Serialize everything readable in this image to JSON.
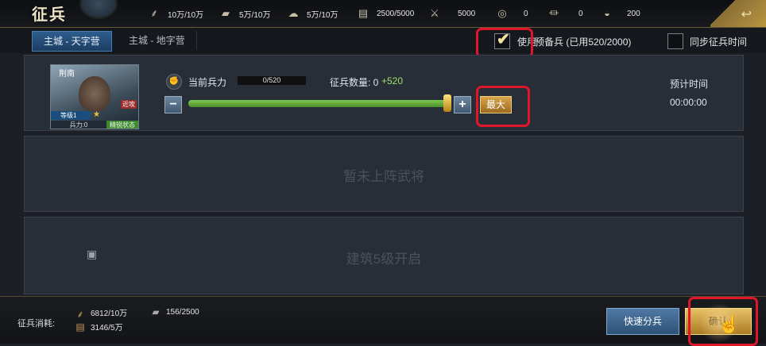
{
  "header": {
    "title": "征兵",
    "resources": [
      {
        "icon": "wood-icon",
        "value": "10万/10万"
      },
      {
        "icon": "iron-icon",
        "value": "5万/10万"
      },
      {
        "icon": "stone-icon",
        "value": "5万/10万"
      },
      {
        "icon": "grain-icon",
        "value": "2500/5000"
      },
      {
        "icon": "decree-icon",
        "value": "5000"
      },
      {
        "icon": "coin-icon",
        "value": "0"
      },
      {
        "icon": "gold-ingot-icon",
        "value": "0"
      },
      {
        "icon": "jade-icon",
        "value": "200"
      }
    ]
  },
  "tabs": [
    {
      "label": "主城 - 天字营",
      "active": true
    },
    {
      "label": "主城 - 地字营",
      "active": false
    }
  ],
  "options": {
    "use_reserve_label": "使用",
    "reserve_info": "预备兵 (已用520/2000)",
    "sync_label": "同步征兵时间"
  },
  "general": {
    "name": "荆南",
    "tag": "近攻",
    "level": "等级1",
    "troops": "兵力:0",
    "state": "精锐状态",
    "current_troops_label": "当前兵力",
    "current_troops_bar": "0/520",
    "recruit_count_label": "征兵数量: 0",
    "recruit_count_add": "+520",
    "recruit_fill_fraction": 1,
    "max_label": "最大",
    "est_time_label": "预计时间",
    "est_time_value": "00:00:00"
  },
  "slots": {
    "empty_text": "暂未上阵武将",
    "locked_text": "建筑5级开启"
  },
  "footer": {
    "cost_label": "征兵消耗:",
    "costs": [
      {
        "icon": "wood-icon",
        "value": "6812/10万"
      },
      {
        "icon": "iron-icon",
        "value": "156/2500"
      },
      {
        "icon": "grain-icon",
        "value": "3146/5万"
      }
    ],
    "quick_split_label": "快速分兵",
    "confirm_label": "确认"
  }
}
